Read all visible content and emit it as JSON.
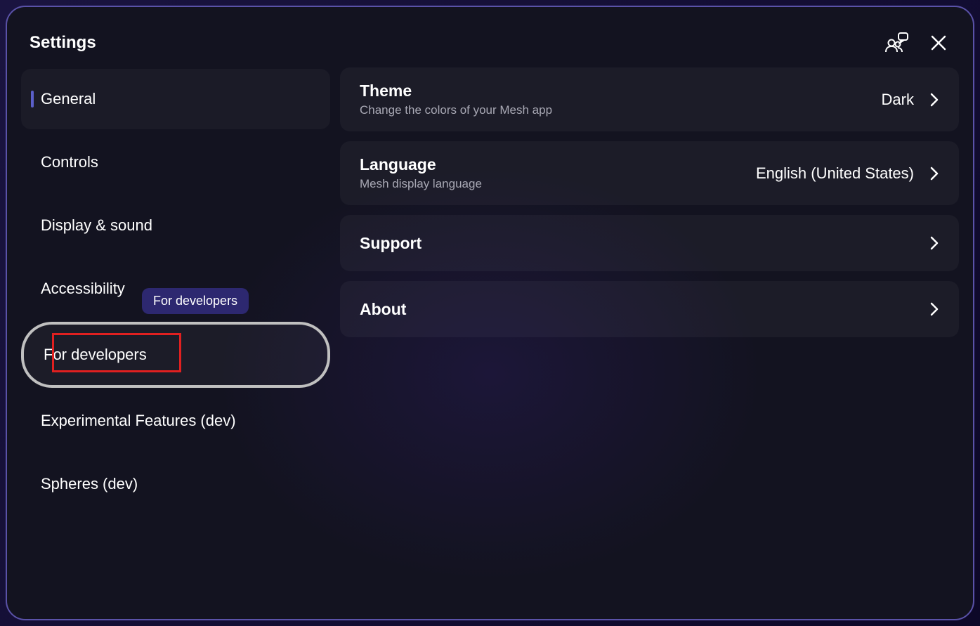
{
  "header": {
    "title": "Settings"
  },
  "sidebar": {
    "items": [
      {
        "label": "General",
        "active": true
      },
      {
        "label": "Controls"
      },
      {
        "label": "Display & sound"
      },
      {
        "label": "Accessibility"
      },
      {
        "label": "For developers",
        "focused": true,
        "tooltip": "For developers",
        "redbox": true
      },
      {
        "label": "Experimental Features (dev)"
      },
      {
        "label": "Spheres (dev)"
      }
    ]
  },
  "settings": [
    {
      "title": "Theme",
      "subtitle": "Change the colors of your Mesh app",
      "value": "Dark"
    },
    {
      "title": "Language",
      "subtitle": "Mesh display language",
      "value": "English (United States)"
    },
    {
      "title": "Support"
    },
    {
      "title": "About"
    }
  ]
}
